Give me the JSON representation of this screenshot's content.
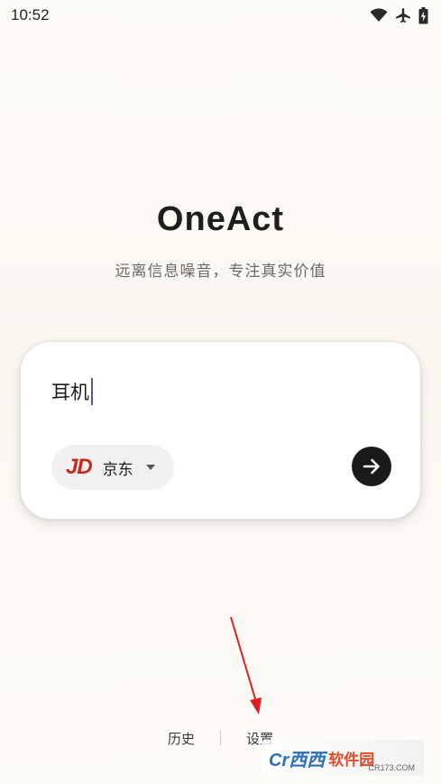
{
  "status_bar": {
    "time": "10:52",
    "icons": [
      "wifi-icon",
      "airplane-icon",
      "battery-charging-icon"
    ]
  },
  "app": {
    "title": "OneAct",
    "subtitle": "远离信息噪音，专注真实价值"
  },
  "search": {
    "query": "耳机",
    "platform": {
      "logo_text": "JD",
      "label": "京东",
      "brand_color": "#c8281e"
    },
    "submit_icon": "arrow-right-icon"
  },
  "bottom_nav": {
    "history": "历史",
    "settings": "设置"
  },
  "watermark": {
    "main": "Cr西西",
    "sub": "软件园",
    "url": "CR173.COM"
  },
  "colors": {
    "accent": "#1a1a1a",
    "caret": "#6a4e9a",
    "annotation": "#e02020"
  }
}
